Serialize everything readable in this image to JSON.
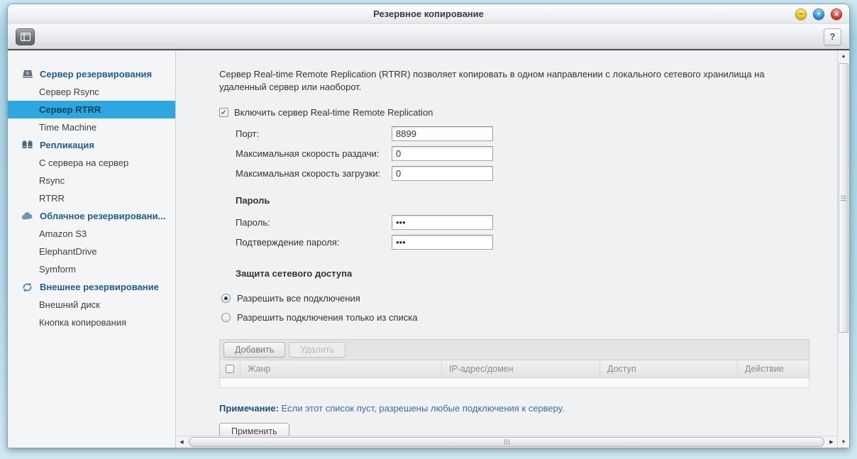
{
  "window": {
    "title": "Резервное копирование",
    "controls": {
      "minimize": "−",
      "maximize": "+",
      "close": "✕"
    },
    "help_label": "?"
  },
  "sidebar": {
    "groups": [
      {
        "icon": "backup-server-icon",
        "label": "Сервер резервирования",
        "items": [
          {
            "label": "Сервер Rsync",
            "selected": false
          },
          {
            "label": "Сервер RTRR",
            "selected": true
          },
          {
            "label": "Time Machine",
            "selected": false
          }
        ]
      },
      {
        "icon": "replication-icon",
        "label": "Репликация",
        "items": [
          {
            "label": "С сервера на сервер",
            "selected": false
          },
          {
            "label": "Rsync",
            "selected": false
          },
          {
            "label": "RTRR",
            "selected": false
          }
        ]
      },
      {
        "icon": "cloud-icon",
        "label": "Облачное резервировани...",
        "items": [
          {
            "label": "Amazon S3",
            "selected": false
          },
          {
            "label": "ElephantDrive",
            "selected": false
          },
          {
            "label": "Symform",
            "selected": false
          }
        ]
      },
      {
        "icon": "sync-icon",
        "label": "Внешнее резервирование",
        "items": [
          {
            "label": "Внешний диск",
            "selected": false
          },
          {
            "label": "Кнопка копирования",
            "selected": false
          }
        ]
      }
    ]
  },
  "main": {
    "description": "Сервер Real-time Remote Replication (RTRR) позволяет копировать в одном направлении с локального сетевого хранилища на удаленный сервер или наоборот.",
    "enable_checkbox": {
      "checked": true,
      "check_glyph": "✔",
      "label": "Включить сервер Real-time Remote Replication"
    },
    "fields": [
      {
        "label": "Порт:",
        "value": "8899"
      },
      {
        "label": "Максимальная скорость раздачи:",
        "value": "0"
      },
      {
        "label": "Максимальная скорость загрузки:",
        "value": "0"
      }
    ],
    "password_section": {
      "title": "Пароль",
      "fields": [
        {
          "label": "Пароль:",
          "value": "•••"
        },
        {
          "label": "Подтверждение пароля:",
          "value": "•••"
        }
      ]
    },
    "access_section": {
      "title": "Защита сетевого доступа",
      "options": [
        {
          "label": "Разрешить все подключения",
          "selected": true
        },
        {
          "label": "Разрешить подключения только из списка",
          "selected": false
        }
      ]
    },
    "table": {
      "buttons": [
        {
          "label": "Добавить",
          "enabled": true
        },
        {
          "label": "Удалить",
          "enabled": false
        }
      ],
      "columns": [
        "Жанр",
        "IP-адрес/домен",
        "Доступ",
        "Действие"
      ]
    },
    "note": {
      "label": "Примечание:",
      "text": "Если этот список пуст, разрешены любые подключения к серверу."
    },
    "apply_label": "Применить"
  },
  "colors": {
    "selection_blue": "#2ea7e0",
    "group_header_blue": "#215e8c",
    "note_bold_blue": "#1c4e7e",
    "note_text_blue": "#3a6ca6",
    "toolbar_divider": "#46494e"
  }
}
